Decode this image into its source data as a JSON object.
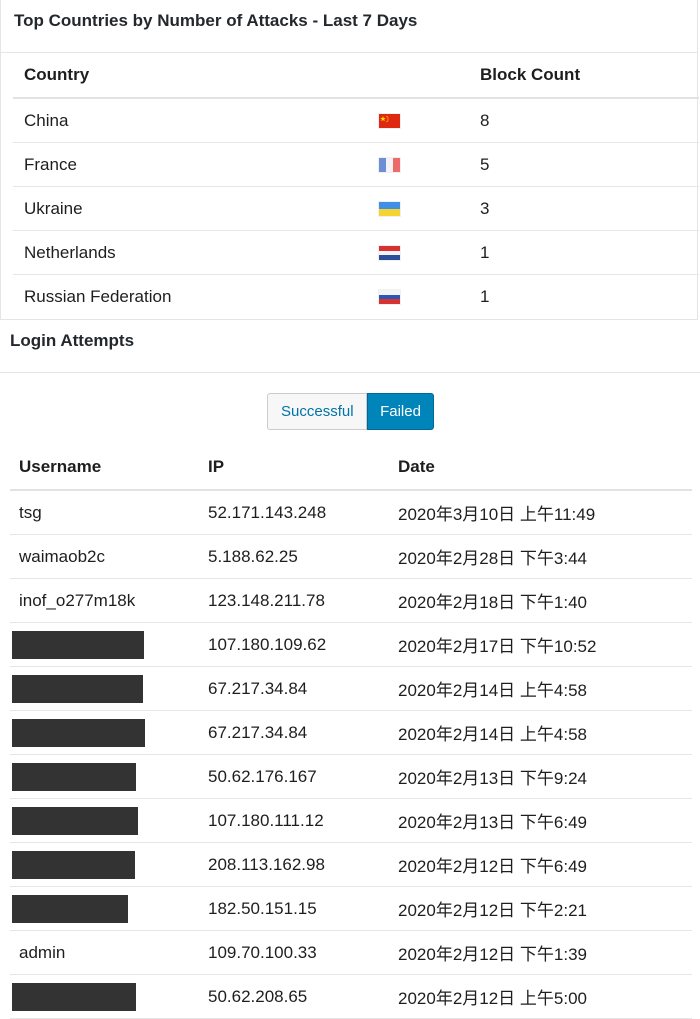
{
  "countries": {
    "title": "Top Countries by Number of Attacks - Last 7 Days",
    "headers": {
      "country": "Country",
      "block_count": "Block Count"
    },
    "rows": [
      {
        "name": "China",
        "count": "8",
        "flag": "cn-flag-icon"
      },
      {
        "name": "France",
        "count": "5",
        "flag": "fr-flag-icon"
      },
      {
        "name": "Ukraine",
        "count": "3",
        "flag": "ua-flag-icon"
      },
      {
        "name": "Netherlands",
        "count": "1",
        "flag": "nl-flag-icon"
      },
      {
        "name": "Russian Federation",
        "count": "1",
        "flag": "ru-flag-icon"
      }
    ]
  },
  "logins": {
    "title": "Login Attempts",
    "toggle": {
      "successful": "Successful",
      "failed": "Failed",
      "active": "failed"
    },
    "headers": {
      "username": "Username",
      "ip": "IP",
      "date": "Date"
    },
    "rows": [
      {
        "username": "tsg",
        "redacted": false,
        "ip": "52.171.143.248",
        "date": "2020年3月10日 上午11:49"
      },
      {
        "username": "waimaob2c",
        "redacted": false,
        "ip": "5.188.62.25",
        "date": "2020年2月28日 下午3:44"
      },
      {
        "username": "inof_o277m18k",
        "redacted": false,
        "ip": "123.148.211.78",
        "date": "2020年2月18日 下午1:40"
      },
      {
        "username": "",
        "redacted": true,
        "ip": "107.180.109.62",
        "date": "2020年2月17日 下午10:52"
      },
      {
        "username": "",
        "redacted": true,
        "ip": "67.217.34.84",
        "date": "2020年2月14日 上午4:58"
      },
      {
        "username": "",
        "redacted": true,
        "ip": "67.217.34.84",
        "date": "2020年2月14日 上午4:58"
      },
      {
        "username": "",
        "redacted": true,
        "ip": "50.62.176.167",
        "date": "2020年2月13日 下午9:24"
      },
      {
        "username": "",
        "redacted": true,
        "ip": "107.180.111.12",
        "date": "2020年2月13日 下午6:49"
      },
      {
        "username": "",
        "redacted": true,
        "ip": "208.113.162.98",
        "date": "2020年2月12日 下午6:49"
      },
      {
        "username": "",
        "redacted": true,
        "ip": "182.50.151.15",
        "date": "2020年2月12日 下午2:21"
      },
      {
        "username": "admin",
        "redacted": false,
        "ip": "109.70.100.33",
        "date": "2020年2月12日 下午1:39"
      },
      {
        "username": "",
        "redacted": true,
        "ip": "50.62.208.65",
        "date": "2020年2月12日 上午5:00"
      }
    ]
  },
  "colors": {
    "accent": "#0085ba",
    "link": "#0073aa",
    "redaction": "#333333"
  }
}
